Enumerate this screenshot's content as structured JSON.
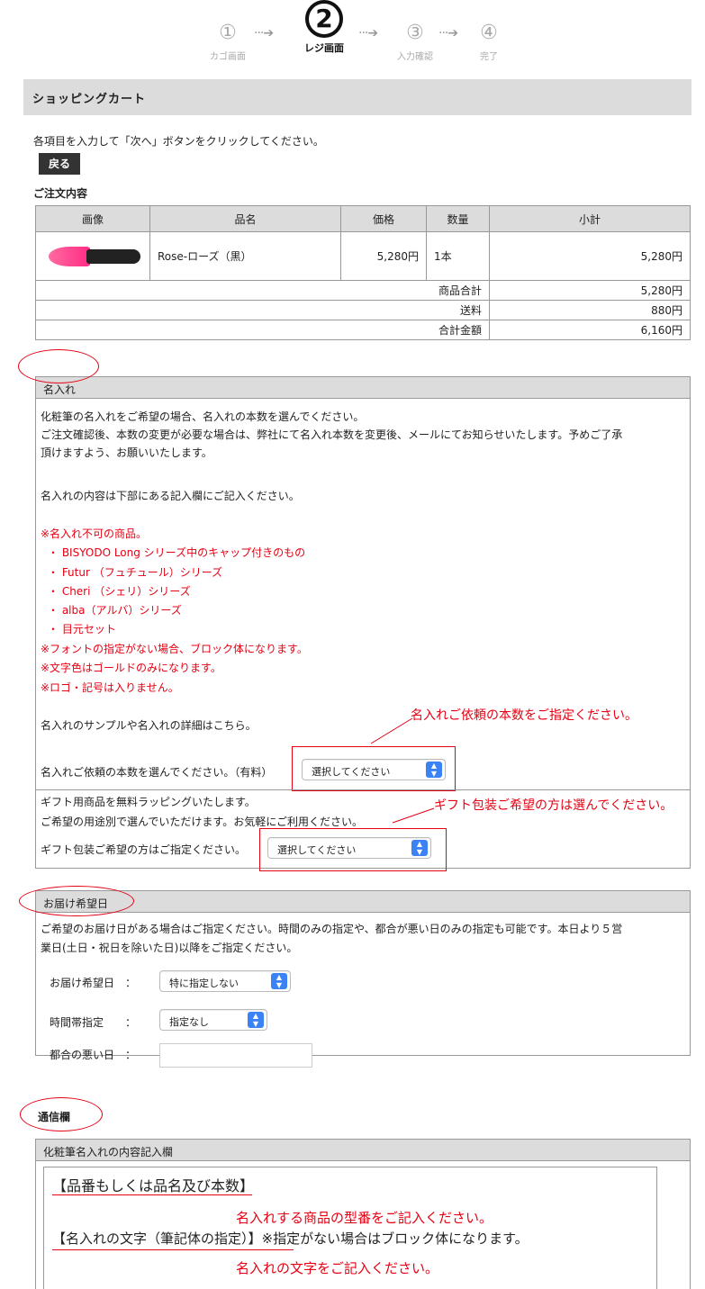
{
  "steps": [
    {
      "num": "①",
      "label": "カゴ画面"
    },
    {
      "num": "2",
      "label": "レジ画面"
    },
    {
      "num": "③",
      "label": "入力確認"
    },
    {
      "num": "④",
      "label": "完了"
    }
  ],
  "arrow": "···➔",
  "cart": {
    "title": "ショッピングカート",
    "instruction": "各項目を入力して「次へ」ボタンをクリックしてください。",
    "back_label": "戻る",
    "order_title": "ご注文内容",
    "columns": [
      "画像",
      "品名",
      "価格",
      "数量",
      "小計"
    ],
    "item": {
      "name": "Rose-ローズ（黒）",
      "price": "5,280円",
      "qty": "1本",
      "subtotal": "5,280円"
    },
    "summary": [
      {
        "label": "商品合計",
        "value": "5,280円"
      },
      {
        "label": "送料",
        "value": "880円"
      },
      {
        "label": "合計金額",
        "value": "6,160円"
      }
    ]
  },
  "naire": {
    "title": "名入れ",
    "p1": "化粧筆の名入れをご希望の場合、名入れの本数を選んでください。",
    "p2a": "ご注文確認後、本数の変更が必要な場合は、弊社にて名入れ本数を変更後、メールにてお知らせいたします。予めご了承",
    "p2b": "頂けますよう、お願いいたします。",
    "p3": "名入れの内容は下部にある記入欄にご記入ください。",
    "ng_title": "※名入れ不可の商品。",
    "ng_items": [
      "・ BISYODO Long シリーズ中のキャップ付きのもの",
      "・ Futur （フュチュール）シリーズ",
      "・ Cheri （シェリ）シリーズ",
      "・ alba（アルバ）シリーズ",
      "・ 目元セット"
    ],
    "note1": "※フォントの指定がない場合、ブロック体になります。",
    "note2": "※文字色はゴールドのみになります。",
    "note3": "※ロゴ・記号は入りません。",
    "sample": "名入れのサンプルや名入れの詳細はこちら。",
    "annot_count": "名入れご依頼の本数をご指定ください。",
    "count_label": "名入れご依頼の本数を選んでください。（有料）",
    "count_select": "選択してください",
    "gift1": "ギフト用商品を無料ラッピングいたします。",
    "gift2": "ご希望の用途別で選んでいただけます。お気軽にご利用ください。",
    "annot_gift": "ギフト包装ご希望の方は選んでください。",
    "gift_label": "ギフト包装ご希望の方はご指定ください。",
    "gift_select": "選択してください"
  },
  "delivery": {
    "title": "お届け希望日",
    "desc1": "ご希望のお届け日がある場合はご指定ください。時間のみの指定や、都合が悪い日のみの指定も可能です。本日より５営",
    "desc2": "業日(土日・祝日を除いた日)以降をご指定ください。",
    "date_label": "お届け希望日　：",
    "date_value": "特に指定しない",
    "time_label": "時間帯指定　　：",
    "time_value": "指定なし",
    "bad_label": "都合の悪い日　：",
    "bad_value": ""
  },
  "memo": {
    "title": "通信欄",
    "box_title": "化粧筆名入れの内容記入欄",
    "line1": "【品番もしくは品名及び本数】",
    "annot1": "名入れする商品の型番をご記入ください。",
    "line2": "【名入れの文字（筆記体の指定）】※指定がない場合はブロック体になります。",
    "annot2": "名入れの文字をご記入ください。"
  },
  "colors": {
    "accent_red": "#e60012",
    "header_gray": "#dcdcdc",
    "select_blue": "#3b82f6"
  }
}
